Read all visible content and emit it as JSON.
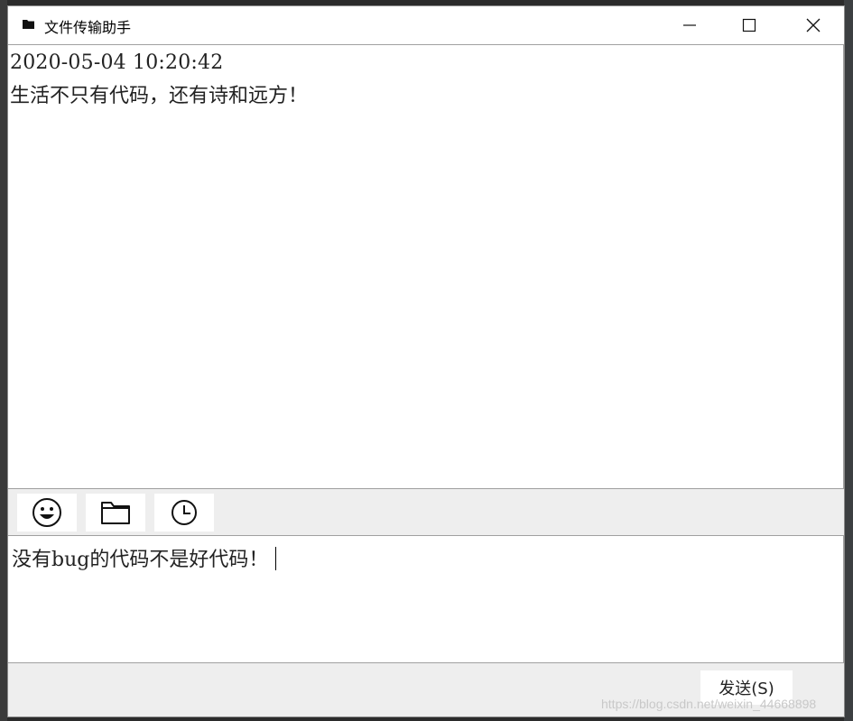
{
  "window": {
    "title": "文件传输助手",
    "title_icon": "folder-icon",
    "controls": {
      "minimize_icon": "minimize-icon",
      "maximize_icon": "maximize-icon",
      "close_icon": "close-icon"
    }
  },
  "chat": {
    "messages": [
      {
        "time": "2020-05-04 10:20:42",
        "text": "生活不只有代码，还有诗和远方！"
      }
    ]
  },
  "toolbar": {
    "buttons": [
      {
        "icon": "emoji-icon"
      },
      {
        "icon": "folder-icon"
      },
      {
        "icon": "clock-icon"
      }
    ]
  },
  "input": {
    "value": "没有bug的代码不是好代码！"
  },
  "footer": {
    "send_label": "发送(S)",
    "watermark": "https://blog.csdn.net/weixin_44668898"
  },
  "colors": {
    "toolbar_bg": "#eeeeee",
    "border": "#a0a0a0",
    "desktop_bg": "#2b2b2b"
  }
}
